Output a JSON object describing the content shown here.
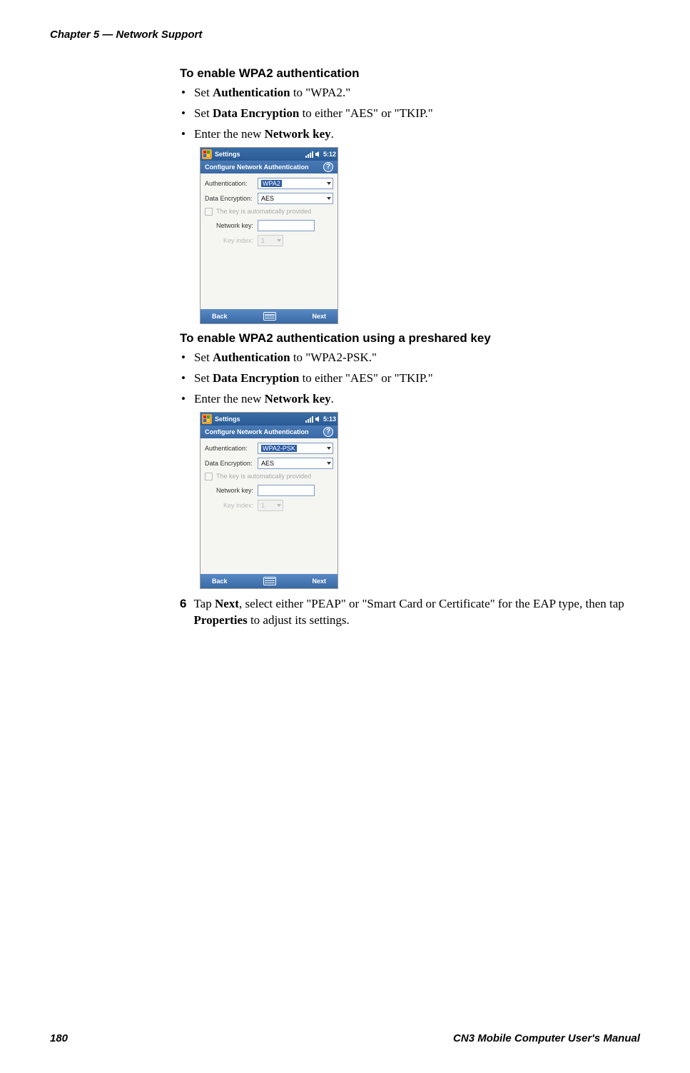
{
  "header": "Chapter 5 — Network Support",
  "footer": {
    "page": "180",
    "manual": "CN3 Mobile Computer User's Manual"
  },
  "section1": {
    "heading": "To enable WPA2 authentication",
    "b1_pre": "Set ",
    "b1_bold": "Authentication",
    "b1_post": " to \"WPA2.\"",
    "b2_pre": "Set ",
    "b2_bold": "Data Encryption",
    "b2_post": " to either \"AES\" or \"TKIP.\"",
    "b3_pre": "Enter the new ",
    "b3_bold": "Network key",
    "b3_post": "."
  },
  "section2": {
    "heading": "To enable WPA2 authentication using a preshared key",
    "b1_pre": "Set ",
    "b1_bold": "Authentication",
    "b1_post": " to \"WPA2-PSK.\"",
    "b2_pre": "Set ",
    "b2_bold": "Data Encryption",
    "b2_post": " to either \"AES\" or \"TKIP.\"",
    "b3_pre": "Enter the new ",
    "b3_bold": "Network key",
    "b3_post": "."
  },
  "step6": {
    "num": "6",
    "t1": "Tap ",
    "bold1": "Next",
    "t2": ", select either \"PEAP\" or \"Smart Card or Certificate\" for the EAP type, then tap ",
    "bold2": "Properties",
    "t3": " to adjust its settings."
  },
  "ss1": {
    "titlebar": "Settings",
    "time": "5:12",
    "subtitle": "Configure Network Authentication",
    "auth_label": "Authentication:",
    "auth_value": "WPA2",
    "enc_label": "Data Encryption:",
    "enc_value": "AES",
    "autokey": "The key is automatically provided",
    "netkey_label": "Network key:",
    "keyindex_label": "Key index:",
    "keyindex_value": "1",
    "back": "Back",
    "next": "Next"
  },
  "ss2": {
    "titlebar": "Settings",
    "time": "5:13",
    "subtitle": "Configure Network Authentication",
    "auth_label": "Authentication:",
    "auth_value": "WPA2-PSK",
    "enc_label": "Data Encryption:",
    "enc_value": "AES",
    "autokey": "The key is automatically provided",
    "netkey_label": "Network key:",
    "keyindex_label": "Key index:",
    "keyindex_value": "1",
    "back": "Back",
    "next": "Next"
  }
}
